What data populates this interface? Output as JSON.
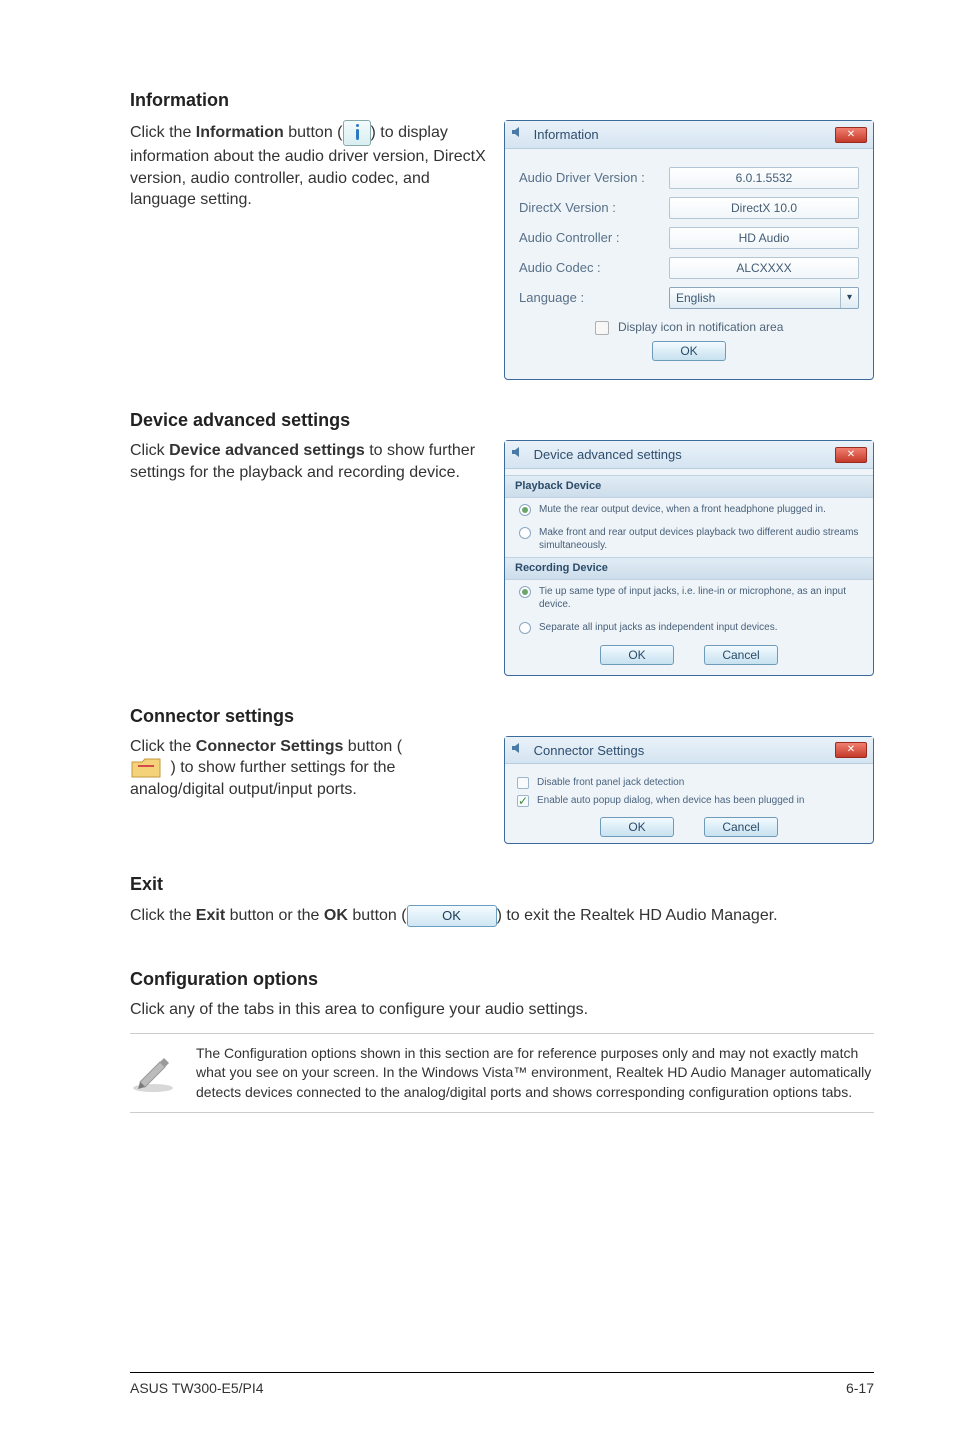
{
  "sections": {
    "info_title": "Information",
    "info_para_pre": "Click the ",
    "info_para_bold": "Information",
    "info_para_mid": " button (",
    "info_para_post": ") to display information about the audio driver version, DirectX version, audio controller, audio codec, and language setting.",
    "adv_title": "Device advanced settings",
    "adv_para_pre": "Click ",
    "adv_para_bold": "Device advanced settings",
    "adv_para_post": " to show further settings for the playback and recording device.",
    "conn_title": "Connector settings",
    "conn_para_pre": "Click the ",
    "conn_para_bold": "Connector Settings",
    "conn_para_mid": " button (",
    "conn_para_post": ") to show further settings for the analog/digital output/input ports.",
    "exit_title": "Exit",
    "exit_para_pre": "Click the ",
    "exit_para_b1": "Exit",
    "exit_para_mid1": " button or the ",
    "exit_para_b2": "OK",
    "exit_para_mid2": " button (",
    "exit_para_post": ") to exit the Realtek HD Audio Manager.",
    "exit_ok_label": "OK",
    "cfg_title": "Configuration options",
    "cfg_para": "Click any of the tabs in this area to configure your audio settings.",
    "note_text": "The Configuration options shown in this section are for reference purposes only and may not exactly match what you see on your screen. In the Windows Vista™ environment, Realtek HD Audio Manager automatically detects devices connected to the analog/digital ports and shows corresponding  configuration options tabs."
  },
  "info_dialog": {
    "title": "Information",
    "rows": {
      "driver_label": "Audio Driver Version :",
      "driver_val": "6.0.1.5532",
      "directx_label": "DirectX Version :",
      "directx_val": "DirectX 10.0",
      "controller_label": "Audio Controller :",
      "controller_val": "HD Audio",
      "codec_label": "Audio Codec :",
      "codec_val": "ALCXXXX",
      "lang_label": "Language :",
      "lang_val": "English"
    },
    "checkbox_label": "Display icon in notification area",
    "ok": "OK"
  },
  "adv_dialog": {
    "title": "Device advanced settings",
    "playback_h": "Playback Device",
    "pb_opt1": "Mute the rear output device, when a front headphone plugged in.",
    "pb_opt2": "Make front and rear output devices playback two different audio streams simultaneously.",
    "recording_h": "Recording Device",
    "rc_opt1": "Tie up same type of input jacks, i.e. line-in or microphone, as an input device.",
    "rc_opt2": "Separate all input jacks as independent input devices.",
    "ok": "OK",
    "cancel": "Cancel"
  },
  "conn_dialog": {
    "title": "Connector Settings",
    "opt1": "Disable front panel jack detection",
    "opt2": "Enable auto popup dialog, when device has been plugged in",
    "ok": "OK",
    "cancel": "Cancel"
  },
  "footer": {
    "left": "ASUS TW300-E5/PI4",
    "right": "6-17"
  }
}
